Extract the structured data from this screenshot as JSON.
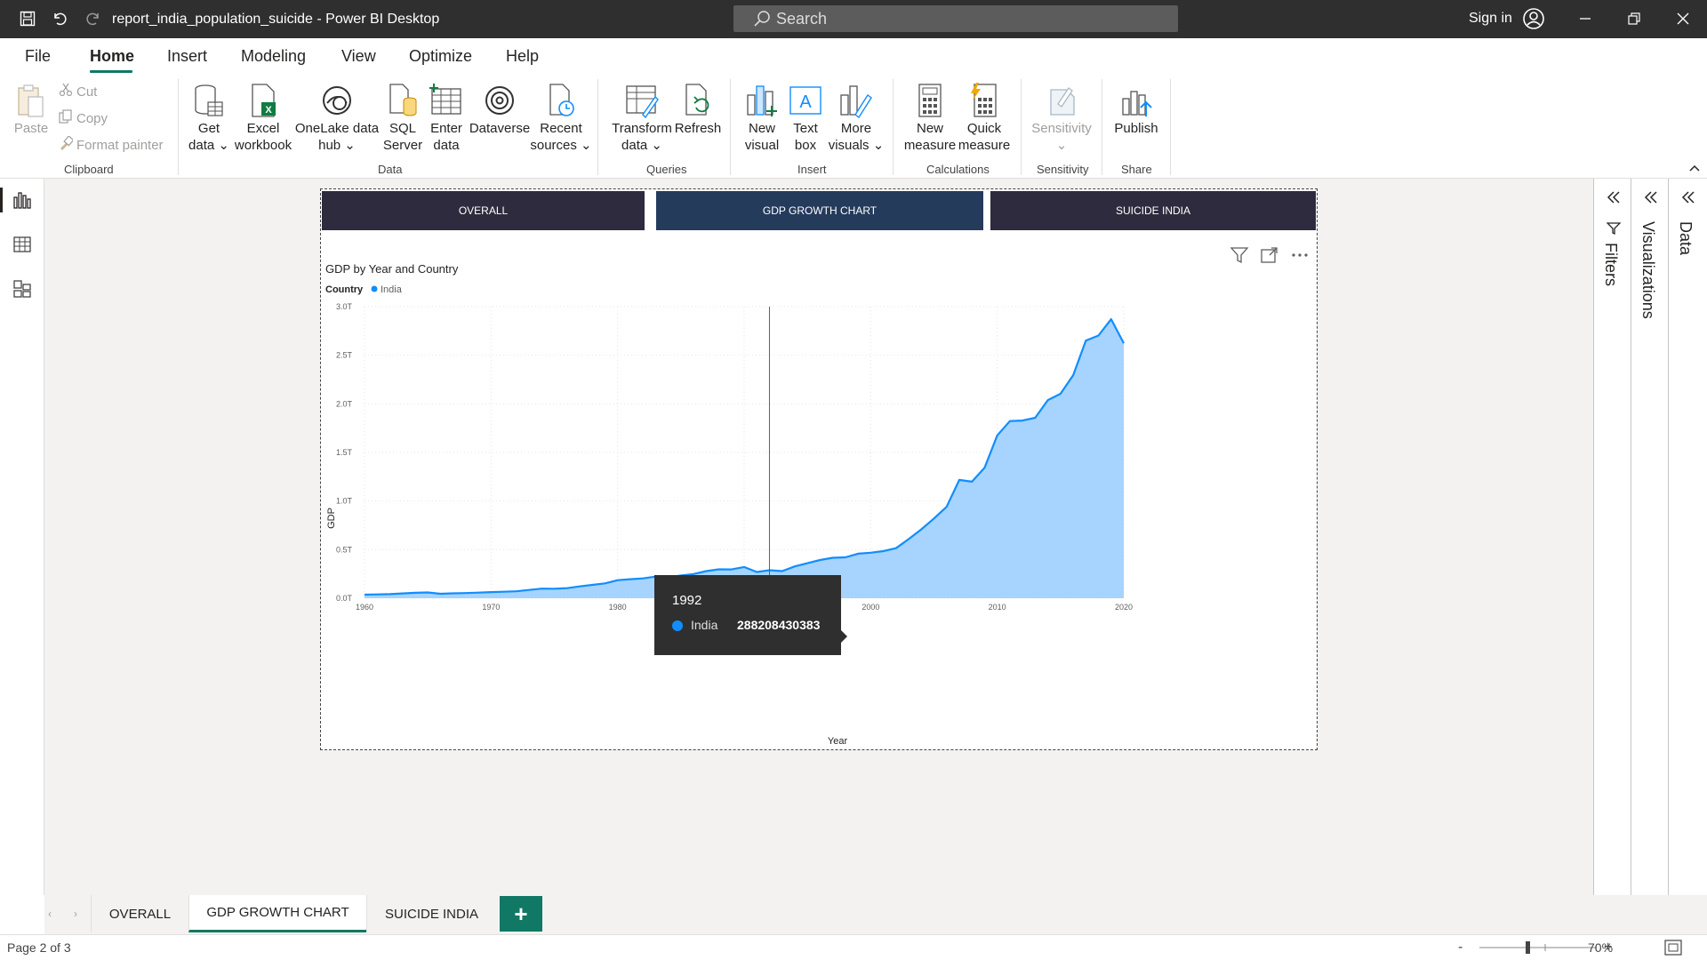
{
  "window": {
    "title": "report_india_population_suicide - Power BI Desktop",
    "search_placeholder": "Search",
    "signin_label": "Sign in"
  },
  "menu": {
    "tabs": [
      "File",
      "Home",
      "Insert",
      "Modeling",
      "View",
      "Optimize",
      "Help"
    ],
    "active": "Home"
  },
  "ribbon": {
    "clipboard": {
      "paste": "Paste",
      "cut": "Cut",
      "copy": "Copy",
      "format_painter": "Format painter",
      "group": "Clipboard"
    },
    "data": {
      "get_data": [
        "Get",
        "data"
      ],
      "excel": [
        "Excel",
        "workbook"
      ],
      "onelake": [
        "OneLake data",
        "hub"
      ],
      "sql": [
        "SQL",
        "Server"
      ],
      "enter": [
        "Enter",
        "data"
      ],
      "dataverse": [
        "Dataverse"
      ],
      "recent": [
        "Recent",
        "sources"
      ],
      "group": "Data"
    },
    "queries": {
      "transform": [
        "Transform",
        "data"
      ],
      "refresh": [
        "Refresh"
      ],
      "group": "Queries"
    },
    "insert": {
      "new_visual": [
        "New",
        "visual"
      ],
      "text_box": [
        "Text",
        "box"
      ],
      "more_visuals": [
        "More",
        "visuals"
      ],
      "group": "Insert"
    },
    "calculations": {
      "new_measure": [
        "New",
        "measure"
      ],
      "quick_measure": [
        "Quick",
        "measure"
      ],
      "group": "Calculations"
    },
    "sensitivity": {
      "label": "Sensitivity",
      "group": "Sensitivity"
    },
    "share": {
      "publish": "Publish",
      "group": "Share"
    }
  },
  "report": {
    "nav_buttons": [
      "OVERALL",
      "GDP GROWTH CHART",
      "SUICIDE INDIA"
    ],
    "active_nav": "GDP GROWTH CHART"
  },
  "chart_data": {
    "type": "area",
    "title": "GDP by Year and Country",
    "legend_title": "Country",
    "xlabel": "Year",
    "ylabel": "GDP",
    "xlim": [
      1960,
      2020
    ],
    "ylim": [
      0,
      3.0
    ],
    "y_unit": "T",
    "x_ticks": [
      "1960",
      "1970",
      "1980",
      "1990",
      "2000",
      "2010",
      "2020"
    ],
    "y_ticks": [
      "0.0T",
      "0.5T",
      "1.0T",
      "1.5T",
      "2.0T",
      "2.5T",
      "3.0T"
    ],
    "color": "#118DFF",
    "fill_color": "#A6D4FF",
    "series": [
      {
        "name": "India",
        "x": [
          1960,
          1961,
          1962,
          1963,
          1964,
          1965,
          1966,
          1967,
          1968,
          1969,
          1970,
          1971,
          1972,
          1973,
          1974,
          1975,
          1976,
          1977,
          1978,
          1979,
          1980,
          1981,
          1982,
          1983,
          1984,
          1985,
          1986,
          1987,
          1988,
          1989,
          1990,
          1991,
          1992,
          1993,
          1994,
          1995,
          1996,
          1997,
          1998,
          1999,
          2000,
          2001,
          2002,
          2003,
          2004,
          2005,
          2006,
          2007,
          2008,
          2009,
          2010,
          2011,
          2012,
          2013,
          2014,
          2015,
          2016,
          2017,
          2018,
          2019,
          2020
        ],
        "values": [
          0.037,
          0.039,
          0.042,
          0.049,
          0.056,
          0.059,
          0.046,
          0.05,
          0.053,
          0.058,
          0.063,
          0.067,
          0.071,
          0.085,
          0.099,
          0.098,
          0.103,
          0.122,
          0.137,
          0.153,
          0.186,
          0.196,
          0.204,
          0.222,
          0.218,
          0.233,
          0.249,
          0.279,
          0.297,
          0.296,
          0.321,
          0.27,
          0.288,
          0.279,
          0.327,
          0.36,
          0.393,
          0.416,
          0.421,
          0.458,
          0.468,
          0.485,
          0.515,
          0.608,
          0.709,
          0.82,
          0.94,
          1.217,
          1.199,
          1.342,
          1.676,
          1.823,
          1.828,
          1.857,
          2.039,
          2.104,
          2.295,
          2.651,
          2.703,
          2.871,
          2.623
        ]
      }
    ],
    "tooltip": {
      "year": "1992",
      "series": "India",
      "value": "288208430383"
    }
  },
  "page_tabs": {
    "tabs": [
      "OVERALL",
      "GDP GROWTH CHART",
      "SUICIDE INDIA"
    ],
    "active": "GDP GROWTH CHART"
  },
  "right_panes": {
    "filters": "Filters",
    "visualizations": "Visualizations",
    "data": "Data"
  },
  "status": {
    "page": "Page 2 of 3",
    "zoom": "70%"
  }
}
